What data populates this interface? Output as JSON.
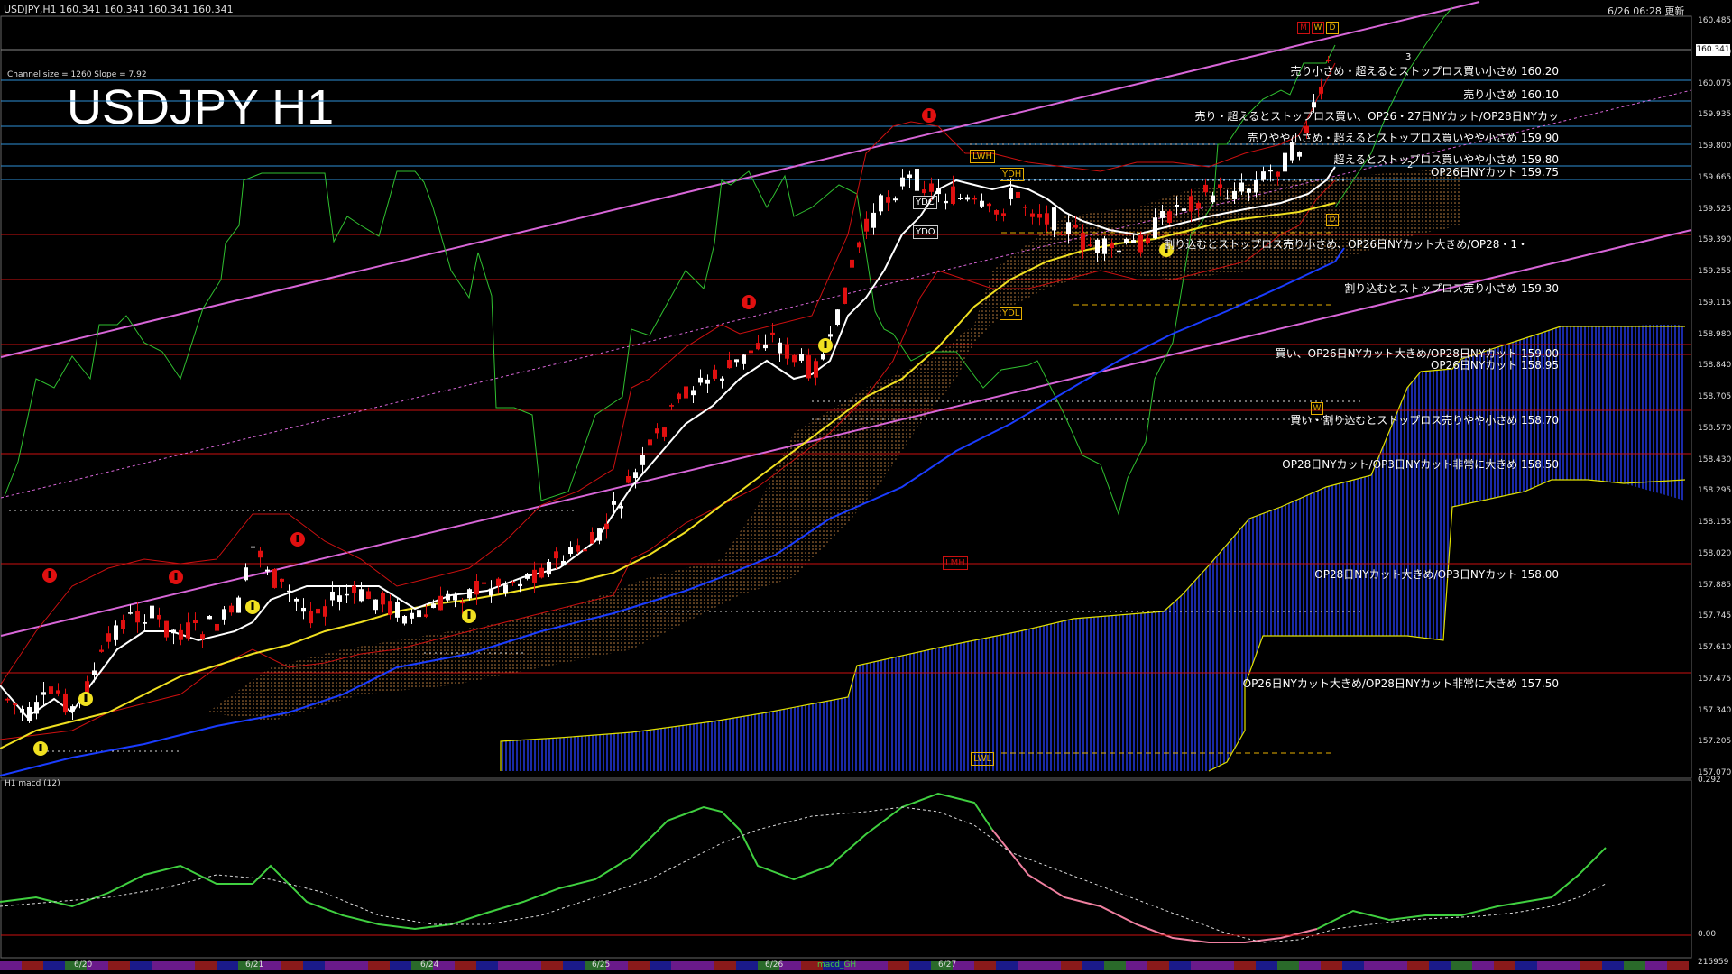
{
  "header": {
    "symbol_info": "USDJPY,H1  160.341 160.341 160.341 160.341",
    "datetime": "6/26 06:28 更新",
    "big_title": "USDJPY H1",
    "channel_info": "Channel size = 1260 Slope = 7.92",
    "current_price": "160.341"
  },
  "price_axis": [
    "160.485",
    "160.210",
    "160.075",
    "159.935",
    "159.800",
    "159.665",
    "159.525",
    "159.390",
    "159.255",
    "159.115",
    "158.980",
    "158.840",
    "158.705",
    "158.570",
    "158.430",
    "158.295",
    "158.155",
    "158.020",
    "157.885",
    "157.745",
    "157.610",
    "157.475",
    "157.340",
    "157.205",
    "157.070"
  ],
  "levels": [
    {
      "text": "売り小さめ・超えるとストップロス買い小さめ 160.20"
    },
    {
      "text": "売り小さめ 160.10"
    },
    {
      "text": "売り・超えるとストップロス買い、OP26・27日NYカット/OP28日NYカッ"
    },
    {
      "text": "売りやや小さめ・超えるとストップロス買いやや小さめ 159.90"
    },
    {
      "text": "超えるとストップロス買いやや小さめ 159.80"
    },
    {
      "text": "OP26日NYカット 159.75"
    },
    {
      "text": "割り込むとストップロス売り小さめ、OP26日NYカット大きめ/OP28・1・"
    },
    {
      "text": "割り込むとストップロス売り小さめ 159.30"
    },
    {
      "text": "買い、OP26日NYカット大きめ/OP28日NYカット 159.00"
    },
    {
      "text": "OP26日NYカット 158.95"
    },
    {
      "text": "買い・割り込むとストップロス売りやや小さめ 158.70"
    },
    {
      "text": "OP28日NYカット/OP3日NYカット非常に大きめ 158.50"
    },
    {
      "text": "OP28日NYカット大きめ/OP3日NYカット 158.00"
    },
    {
      "text": "OP26日NYカット大きめ/OP28日NYカット非常に大きめ 157.50"
    }
  ],
  "tags": {
    "lwh": "LWH",
    "ydh": "YDH",
    "ydc": "YDC",
    "ydo": "YDO",
    "ydl": "YDL",
    "lmh": "LMH",
    "lwl": "LWL",
    "m": "M",
    "w": "W",
    "d": "D",
    "d2": "D",
    "w2": "W",
    "three": "3",
    "two": "2"
  },
  "macd": {
    "label": "H1  macd (12)",
    "top_value": "0.292",
    "zero_value": "0.00",
    "bottom_value": "215959"
  },
  "dates": [
    "6/20",
    "6/21",
    "6/24",
    "6/25",
    "6/26",
    "6/27"
  ],
  "bottom_label": "macd_GH",
  "colors": {
    "support": "#cc1010",
    "resistance": "#2e8fd6",
    "channel": "#d866d8",
    "sma_white": "#ffffff",
    "sma_yellow": "#f0e020",
    "sma_blue": "#1a3cff",
    "macd_up": "#40d040",
    "macd_down": "#f080a0"
  }
}
